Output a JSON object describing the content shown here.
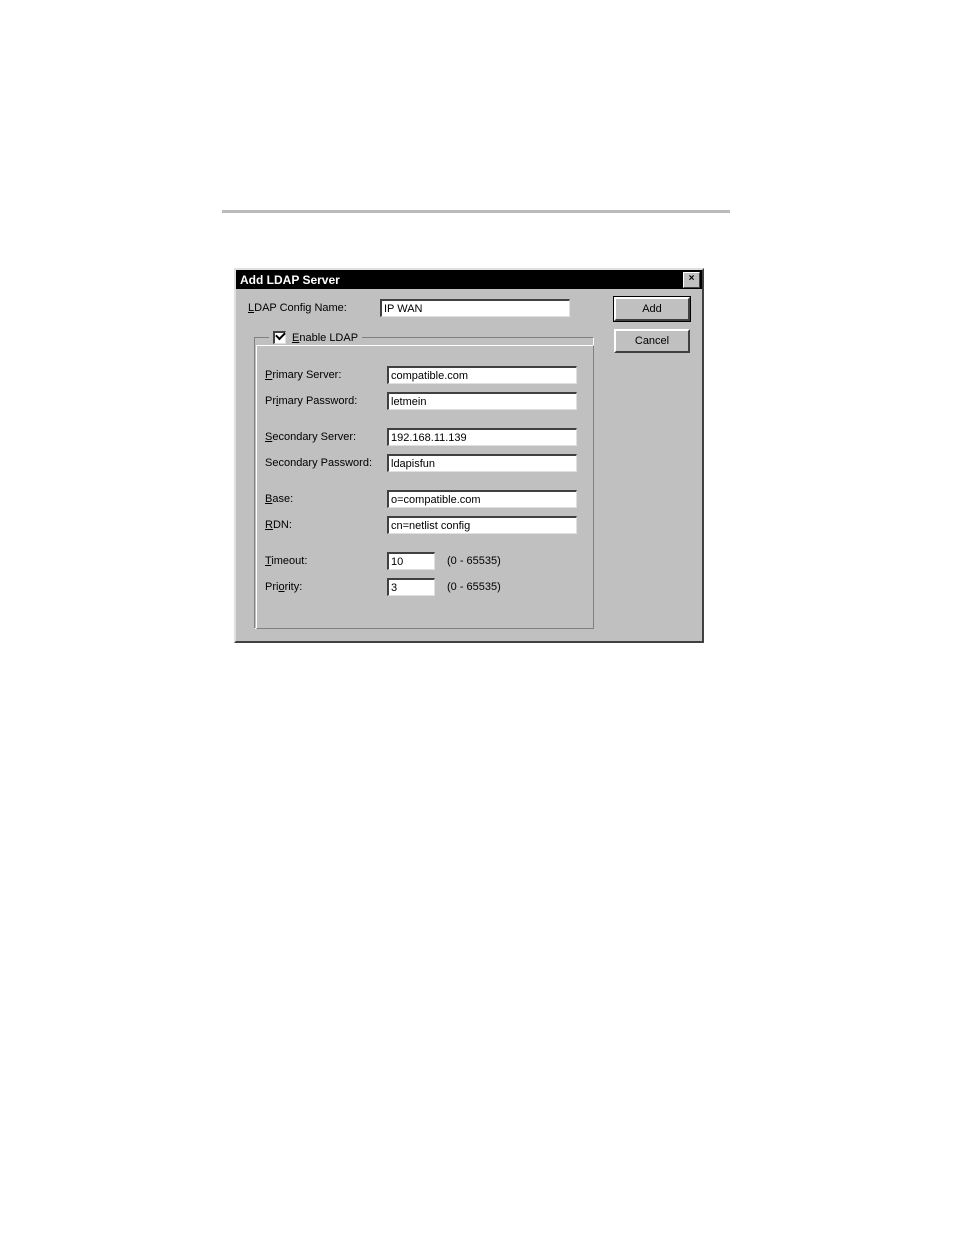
{
  "dialog": {
    "title": "Add LDAP Server",
    "buttons": {
      "add": "Add",
      "cancel": "Cancel",
      "close": "×"
    },
    "config_name_label": "LDAP Config Name:",
    "config_name_underline": "L",
    "config_name_value": "IP WAN",
    "group": {
      "enable_label": "Enable LDAP",
      "enable_underline": "E",
      "enable_checked": true,
      "primary_server_label": "Primary Server:",
      "primary_server_underline": "P",
      "primary_server_value": "compatible.com",
      "primary_password_label": "Primary Password:",
      "primary_password_underline": "i",
      "primary_password_value": "letmein",
      "secondary_server_label": "Secondary Server:",
      "secondary_server_underline": "S",
      "secondary_server_value": "192.168.11.139",
      "secondary_password_label": "Secondary Password:",
      "secondary_password_value": "ldapisfun",
      "base_label": "Base:",
      "base_underline": "B",
      "base_value": "o=compatible.com",
      "rdn_label": "RDN:",
      "rdn_underline": "R",
      "rdn_value": "cn=netlist config",
      "timeout_label": "Timeout:",
      "timeout_underline": "T",
      "timeout_value": "10",
      "timeout_range": "(0 - 65535)",
      "priority_label": "Priority:",
      "priority_underline": "o",
      "priority_value": "3",
      "priority_range": "(0 - 65535)"
    }
  }
}
